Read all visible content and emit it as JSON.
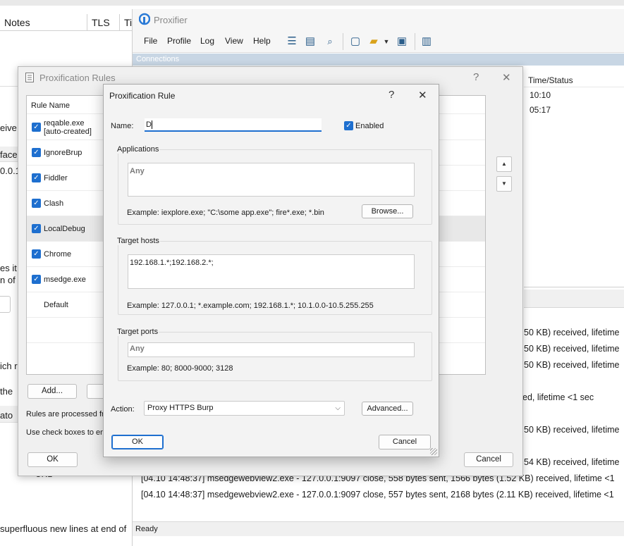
{
  "background_app": {
    "headers": [
      "Notes",
      "TLS",
      "Ti"
    ],
    "fragments": [
      "eive i",
      "face",
      "0.0.1",
      "es it",
      "n of",
      "ich r",
      "the",
      "ato",
      "URL",
      "superfluous new lines at end of"
    ]
  },
  "proxifier": {
    "title": "Proxifier",
    "menu": [
      "File",
      "Profile",
      "Log",
      "View",
      "Help"
    ],
    "connections_label": "Connections",
    "column_header": "Time/Status",
    "times": [
      "10:10",
      "05:17"
    ],
    "log_lines": [
      "50 KB) received, lifetime",
      "50 KB) received, lifetime",
      "50 KB) received, lifetime",
      "ed, lifetime <1 sec",
      "50 KB) received, lifetime",
      "54 KB) received, lifetime",
      "[04.10 14:48:37] msedgewebview2.exe - 127.0.0.1:9097 close, 558 bytes sent, 1566 bytes (1.52 KB) received, lifetime <1",
      "[04.10 14:48:37] msedgewebview2.exe - 127.0.0.1:9097 close, 557 bytes sent, 2168 bytes (2.11 KB) received, lifetime <1"
    ],
    "status": "Ready"
  },
  "rules_dialog": {
    "title": "Proxification Rules",
    "help": "?",
    "close": "✕",
    "column_rule_name": "Rule Name",
    "rules": [
      {
        "name": "reqable.exe",
        "name2": "[auto-created]",
        "checked": true
      },
      {
        "name": "IgnoreBrup",
        "checked": true
      },
      {
        "name": "Fiddler",
        "checked": true
      },
      {
        "name": "Clash",
        "checked": true
      },
      {
        "name": "LocalDebug",
        "checked": true
      },
      {
        "name": "Chrome",
        "checked": true
      },
      {
        "name": "msedge.exe",
        "checked": true
      },
      {
        "name": "Default",
        "checked": false
      }
    ],
    "add_button": "Add...",
    "info1": "Rules are processed fro",
    "info2": "Use check boxes to ena",
    "ok": "OK",
    "cancel": "Cancel"
  },
  "rule_dialog": {
    "title": "Proxification Rule",
    "help": "?",
    "close": "✕",
    "name_label": "Name:",
    "name_value": "D",
    "enabled_label": "Enabled",
    "enabled": true,
    "applications": {
      "label": "Applications",
      "value": "Any",
      "example": "Example: iexplore.exe; \"C:\\some app.exe\"; fire*.exe; *.bin",
      "browse": "Browse..."
    },
    "target_hosts": {
      "label": "Target hosts",
      "value": "192.168.1.*;192.168.2.*;",
      "example": "Example: 127.0.0.1; *.example.com; 192.168.1.*; 10.1.0.0-10.5.255.255"
    },
    "target_ports": {
      "label": "Target ports",
      "value": "Any",
      "example": "Example: 80; 8000-9000; 3128"
    },
    "action_label": "Action:",
    "action_value": "Proxy HTTPS Burp",
    "advanced": "Advanced...",
    "ok": "OK",
    "cancel": "Cancel"
  }
}
